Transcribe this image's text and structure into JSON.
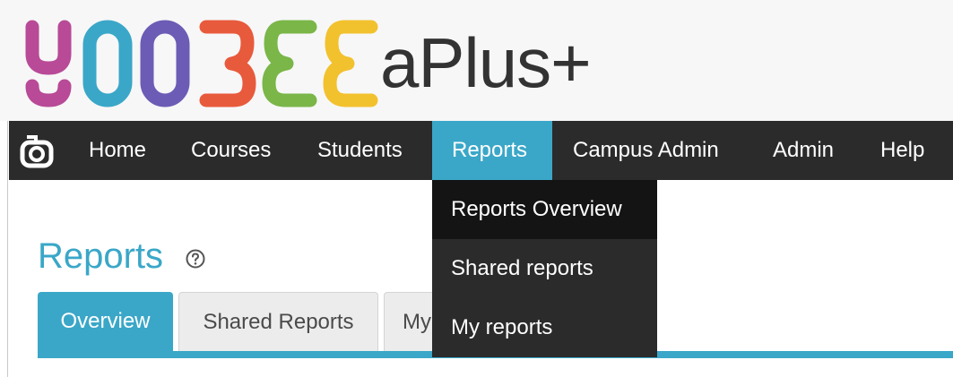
{
  "header": {
    "logo_word": "aPlus+",
    "logo_colors": [
      "#b84a97",
      "#3aa7c8",
      "#6c5cb5",
      "#e85a3c",
      "#7ab648",
      "#f2c12e"
    ]
  },
  "nav": {
    "items": [
      "Home",
      "Courses",
      "Students",
      "Reports",
      "Campus Admin",
      "Admin",
      "Help"
    ],
    "active": "Reports",
    "icon": "camera-logo-icon"
  },
  "dropdown": {
    "items": [
      "Reports Overview",
      "Shared reports",
      "My reports"
    ],
    "highlighted": "Reports Overview"
  },
  "page": {
    "title": "Reports",
    "help_icon": "question-circle-icon"
  },
  "tabs": {
    "items": [
      "Overview",
      "Shared Reports",
      "My"
    ],
    "active": "Overview"
  },
  "colors": {
    "accent": "#3aa7c8",
    "navbar": "#2b2b2b",
    "dropdown_highlight": "#141414"
  }
}
